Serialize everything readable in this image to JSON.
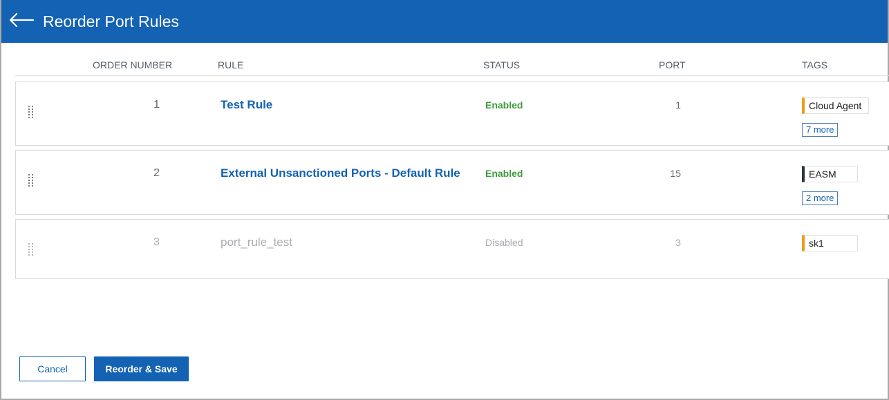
{
  "header": {
    "title": "Reorder Port Rules",
    "back_icon": "arrow-left-icon"
  },
  "columns": {
    "order": "ORDER NUMBER",
    "rule": "RULE",
    "status": "STATUS",
    "port": "PORT",
    "tags": "TAGS"
  },
  "rows": [
    {
      "order": "1",
      "rule": "Test Rule",
      "status": "Enabled",
      "port": "1",
      "tag": "Cloud Agent",
      "tag_color": "#f09a19",
      "more": "7 more"
    },
    {
      "order": "2",
      "rule": "External Unsanctioned Ports - Default Rule",
      "status": "Enabled",
      "port": "15",
      "tag": "EASM",
      "tag_color": "#2c3440",
      "more": "2 more"
    },
    {
      "order": "3",
      "rule": "port_rule_test",
      "status": "Disabled",
      "port": "3",
      "tag": "sk1",
      "tag_color": "#f09a19"
    }
  ],
  "footer": {
    "cancel_label": "Cancel",
    "save_label": "Reorder & Save"
  },
  "colors": {
    "primary": "#1362b3",
    "enabled": "#3e9a3b",
    "disabled": "#a8acb0"
  }
}
